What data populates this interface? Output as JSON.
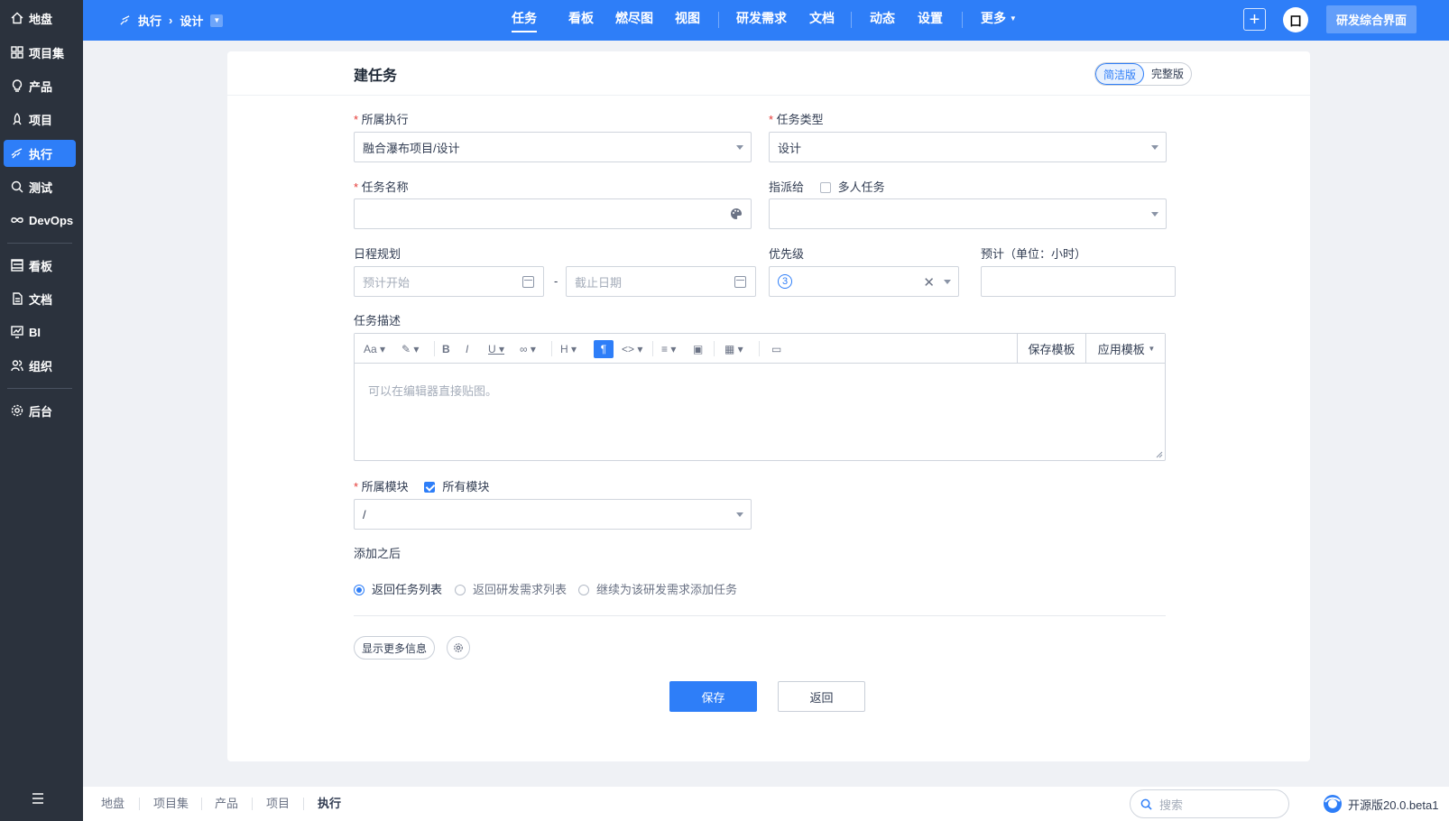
{
  "sidebar": {
    "items": [
      {
        "label": "地盘",
        "icon": "home-icon"
      },
      {
        "label": "项目集",
        "icon": "grid-icon"
      },
      {
        "label": "产品",
        "icon": "bulb-icon"
      },
      {
        "label": "项目",
        "icon": "rocket-icon"
      },
      {
        "label": "执行",
        "icon": "run-icon",
        "active": true
      },
      {
        "label": "测试",
        "icon": "search-icon"
      },
      {
        "label": "DevOps",
        "icon": "infinity-icon"
      },
      {
        "label": "看板",
        "icon": "kanban-icon"
      },
      {
        "label": "文档",
        "icon": "doc-icon"
      },
      {
        "label": "BI",
        "icon": "chart-icon"
      },
      {
        "label": "组织",
        "icon": "people-icon"
      },
      {
        "label": "后台",
        "icon": "gear-icon"
      }
    ]
  },
  "topbar": {
    "breadcrumb": {
      "module": "执行",
      "current": "设计"
    },
    "nav": [
      "任务",
      "看板",
      "燃尽图",
      "视图",
      "研发需求",
      "文档",
      "动态",
      "设置",
      "更多"
    ],
    "active_nav": "任务",
    "avatar_text": "囗",
    "switch_label": "研发综合界面"
  },
  "form": {
    "title": "建任务",
    "mode_simple": "简洁版",
    "mode_full": "完整版",
    "execution_label": "所属执行",
    "execution_value": "融合瀑布项目/设计",
    "type_label": "任务类型",
    "type_value": "设计",
    "name_label": "任务名称",
    "name_value": "",
    "assign_label": "指派给",
    "multi_label": "多人任务",
    "multi_checked": false,
    "schedule_label": "日程规划",
    "start_placeholder": "预计开始",
    "dash": "-",
    "deadline_placeholder": "截止日期",
    "priority_label": "优先级",
    "priority_value": "3",
    "estimate_label": "预计（单位：小时）",
    "desc_label": "任务描述",
    "editor_placeholder": "可以在编辑器直接贴图。",
    "save_template": "保存模板",
    "apply_template": "应用模板",
    "module_label": "所属模块",
    "all_modules_label": "所有模块",
    "all_modules_checked": true,
    "module_value": "/",
    "after_label": "添加之后",
    "after_options": [
      "返回任务列表",
      "返回研发需求列表",
      "继续为该研发需求添加任务"
    ],
    "after_selected": 0,
    "more_info": "显示更多信息",
    "save_button": "保存",
    "back_button": "返回"
  },
  "footer": {
    "breadcrumb": [
      "地盘",
      "项目集",
      "产品",
      "项目",
      "执行"
    ],
    "search_placeholder": "搜索",
    "version": "开源版20.0.beta1"
  },
  "colors": {
    "primary": "#2e7ef8",
    "sidebar": "#2b323d",
    "required": "#e53935"
  }
}
